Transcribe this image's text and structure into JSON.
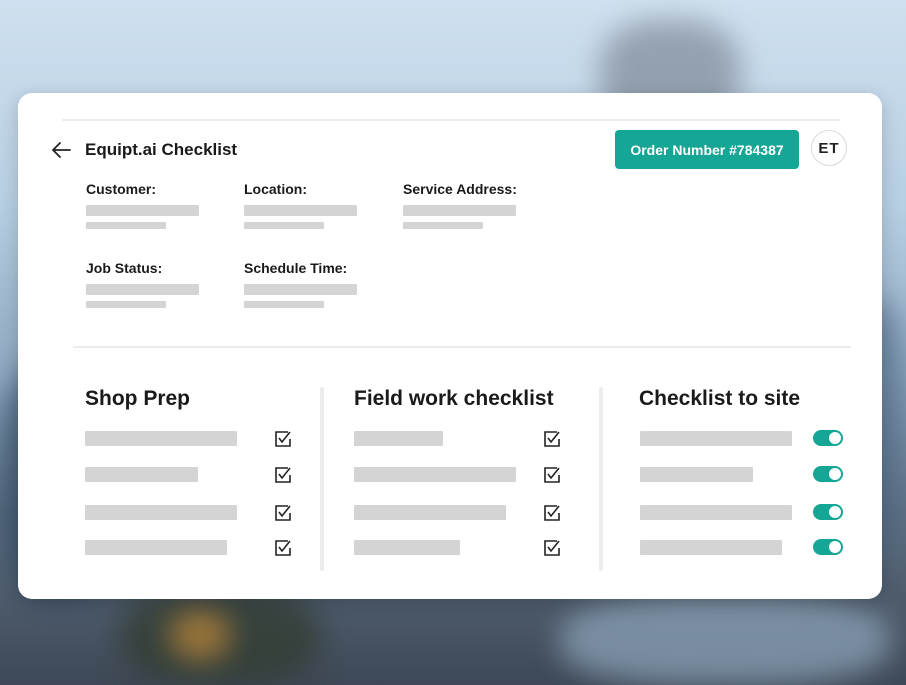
{
  "app": {
    "title": "Equipt.ai Checklist"
  },
  "header": {
    "order_label": "Order Number #784387",
    "avatar_initials": "ET"
  },
  "details": {
    "fields": [
      {
        "label": "Customer:"
      },
      {
        "label": "Location:"
      },
      {
        "label": "Service Address:"
      },
      {
        "label": "Job Status:"
      },
      {
        "label": "Schedule Time:"
      }
    ]
  },
  "sections": [
    {
      "title": "Shop Prep",
      "control": "checkbox",
      "items": 4,
      "icon": "checked-box-icon"
    },
    {
      "title": "Field work checklist",
      "control": "checkbox",
      "items": 4,
      "icon": "checked-box-icon"
    },
    {
      "title": "Checklist to site",
      "control": "toggle",
      "items": 4,
      "toggle_state": "on"
    }
  ],
  "colors": {
    "accent": "#15a695",
    "placeholder": "#d4d4d4",
    "text": "#1a1a1a"
  },
  "icons": {
    "back": "arrow-left-icon",
    "check": "checked-box-icon"
  }
}
